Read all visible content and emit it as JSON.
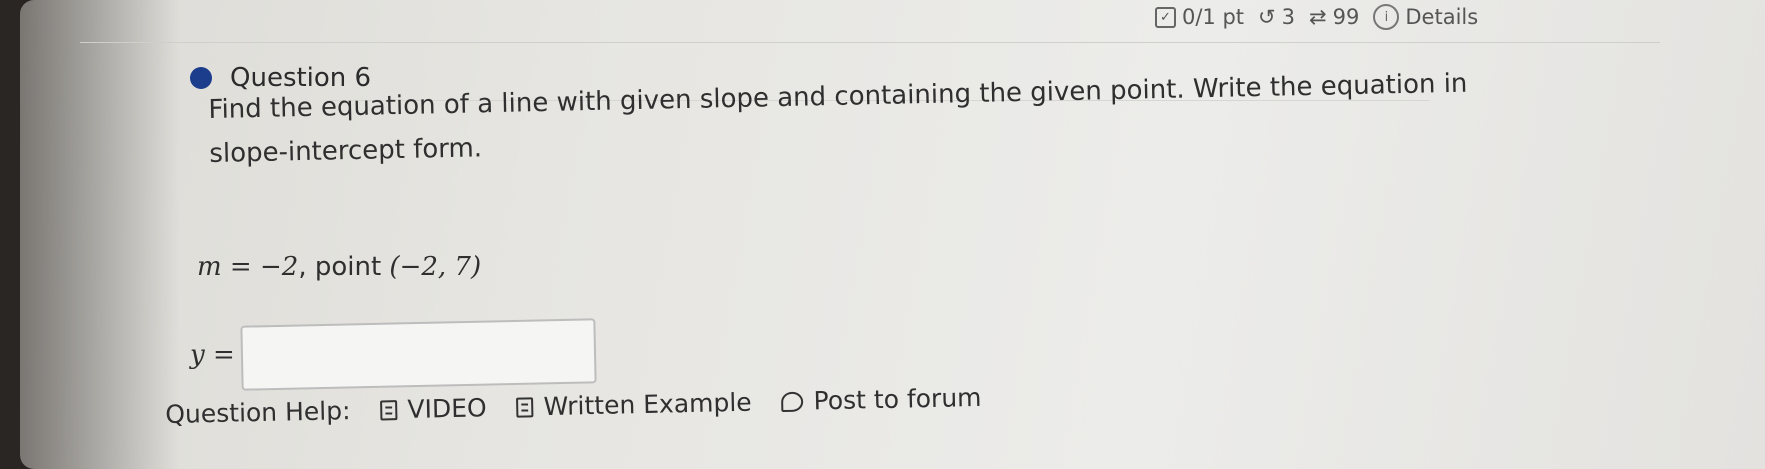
{
  "status_bar": {
    "score": "0/1 pt",
    "retries": "3",
    "submissions": "99",
    "details_label": "Details"
  },
  "question": {
    "title": "Question 6",
    "prompt_line1": "Find the equation of a line with given slope and containing the given point. Write the equation in",
    "prompt_line2": "slope-intercept form.",
    "given_m_var": "m",
    "given_m_eq": "=",
    "given_m_value": "−2",
    "given_point_label": ", point",
    "given_point_value": "(−2, 7)",
    "answer_label": "y =",
    "answer_value": ""
  },
  "help": {
    "label": "Question Help:",
    "video_label": "VIDEO",
    "example_label": "Written Example",
    "forum_label": "Post to forum"
  },
  "colors": {
    "bullet": "#1c3c8c",
    "screen_bg": "#e6e5e1"
  }
}
